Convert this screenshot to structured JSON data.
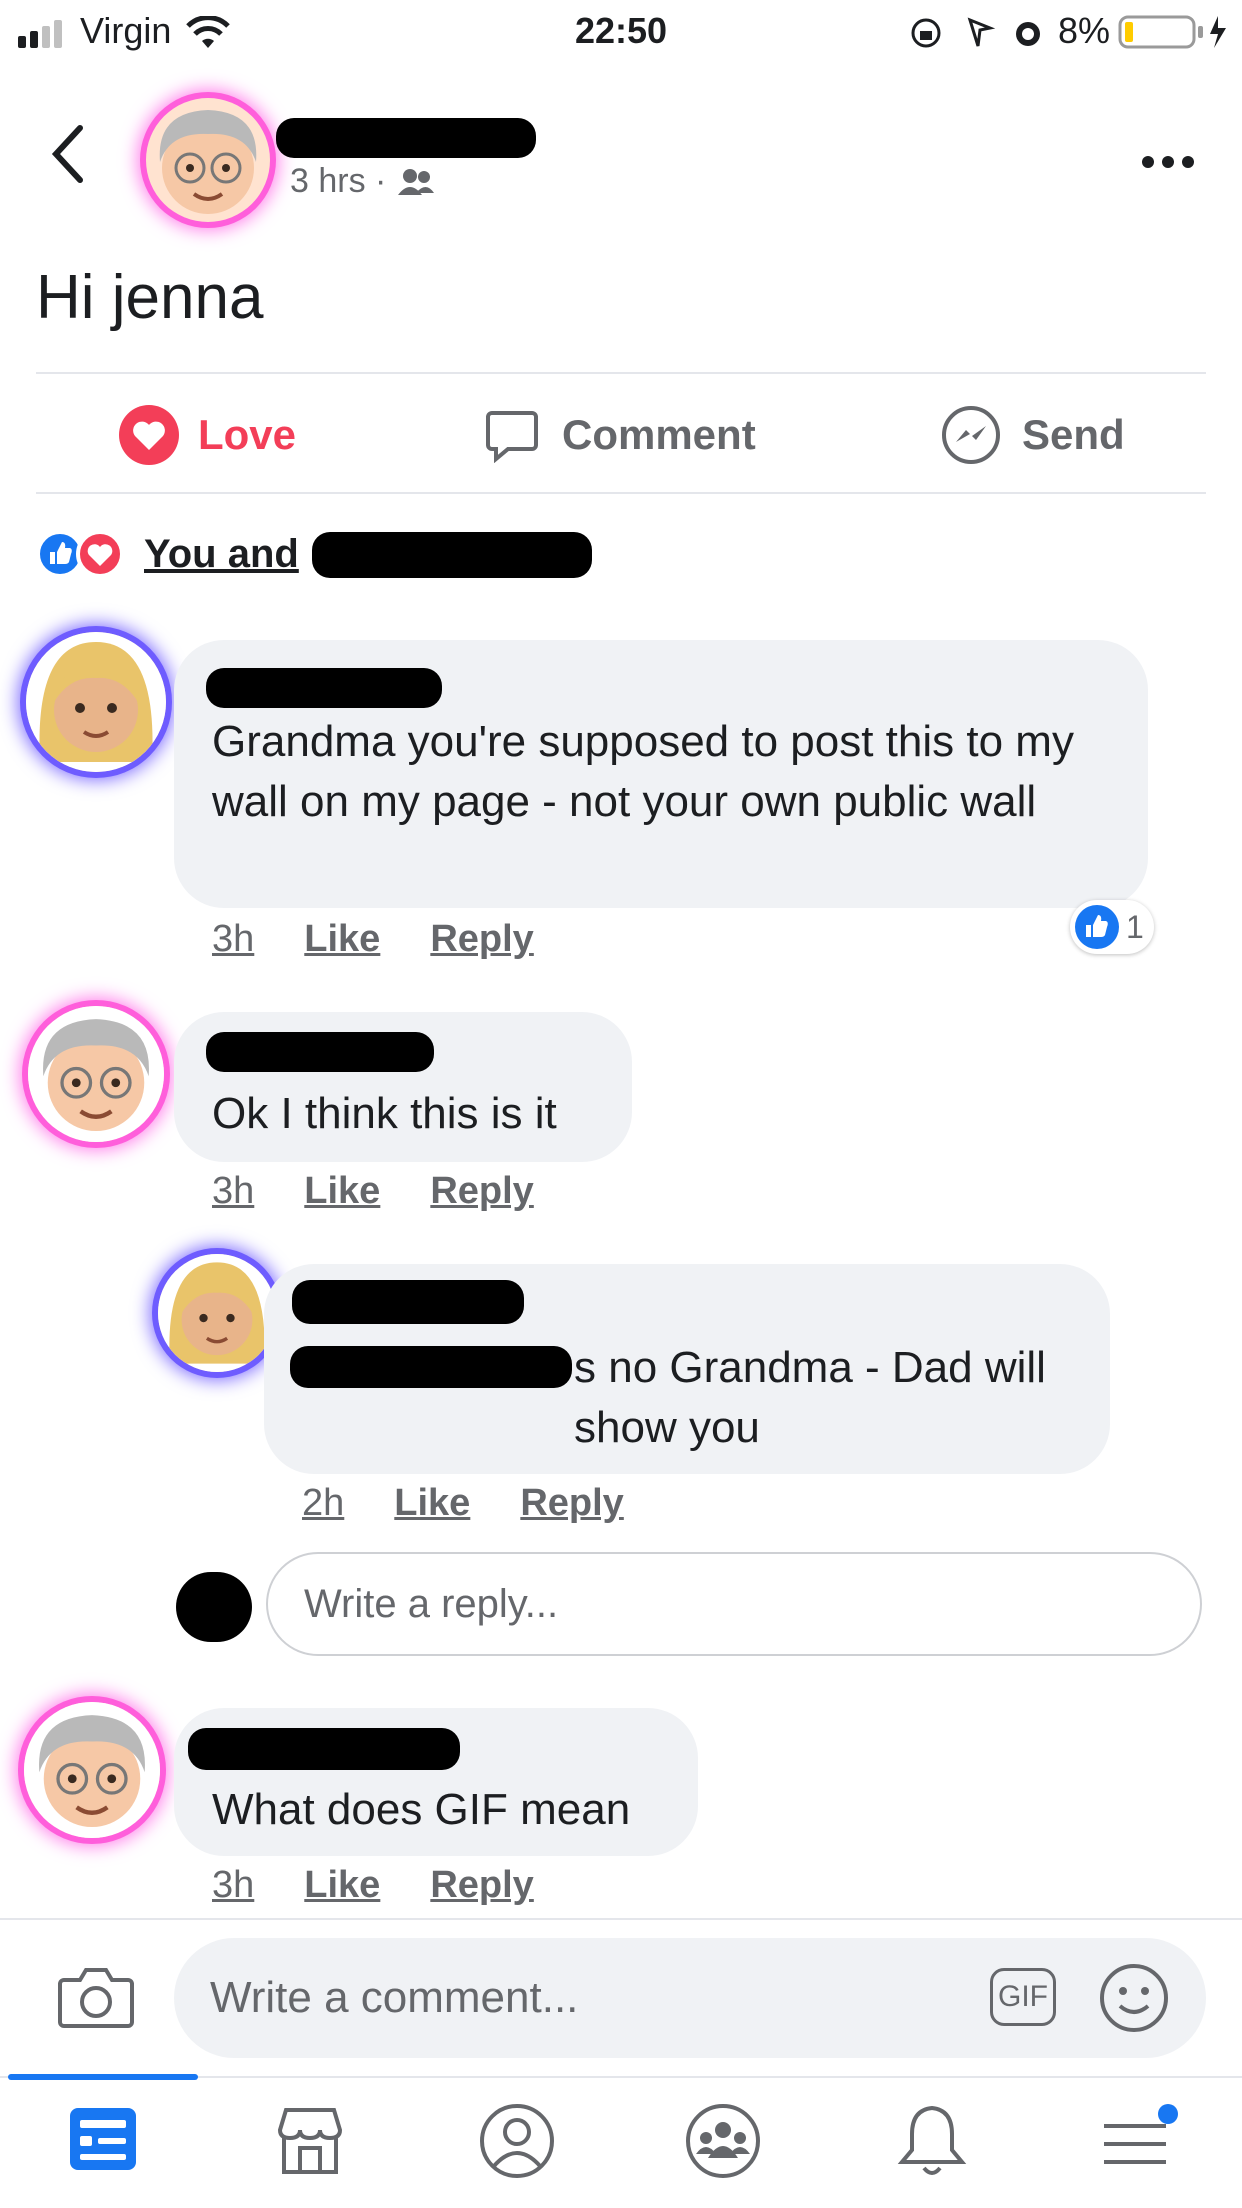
{
  "status_bar": {
    "carrier": "Virgin",
    "time": "22:50",
    "battery": "8%"
  },
  "post": {
    "meta_time": "3 hrs ·",
    "text": "Hi jenna",
    "actions": {
      "love": "Love",
      "comment": "Comment",
      "send": "Send"
    },
    "reactions_label": "You and"
  },
  "comments": [
    {
      "text": "Grandma you're supposed to post this to my wall on my page - not your own public wall",
      "time": "3h",
      "like": "Like",
      "reply": "Reply",
      "like_count": "1"
    },
    {
      "text": "Ok I think this is it",
      "time": "3h",
      "like": "Like",
      "reply": "Reply"
    },
    {
      "text": "s no Grandma - Dad will show you",
      "time": "2h",
      "like": "Like",
      "reply": "Reply"
    },
    {
      "text": "What does GIF mean",
      "time": "3h",
      "like": "Like",
      "reply": "Reply"
    }
  ],
  "reply_input": {
    "placeholder": "Write a reply..."
  },
  "composer": {
    "placeholder": "Write a comment...",
    "gif": "GIF"
  },
  "colors": {
    "facebook_blue": "#1877f2",
    "love_red": "#f33e58",
    "bubble_gray": "#f0f2f5",
    "meta_gray": "#65676b"
  },
  "icons": [
    "chevron-left-icon",
    "more-icon",
    "friends-icon",
    "heart-icon",
    "comment-icon",
    "messenger-icon",
    "like-icon",
    "camera-icon",
    "smiley-icon",
    "news-feed-icon",
    "marketplace-icon",
    "profile-icon",
    "groups-icon",
    "bell-icon",
    "menu-icon"
  ]
}
